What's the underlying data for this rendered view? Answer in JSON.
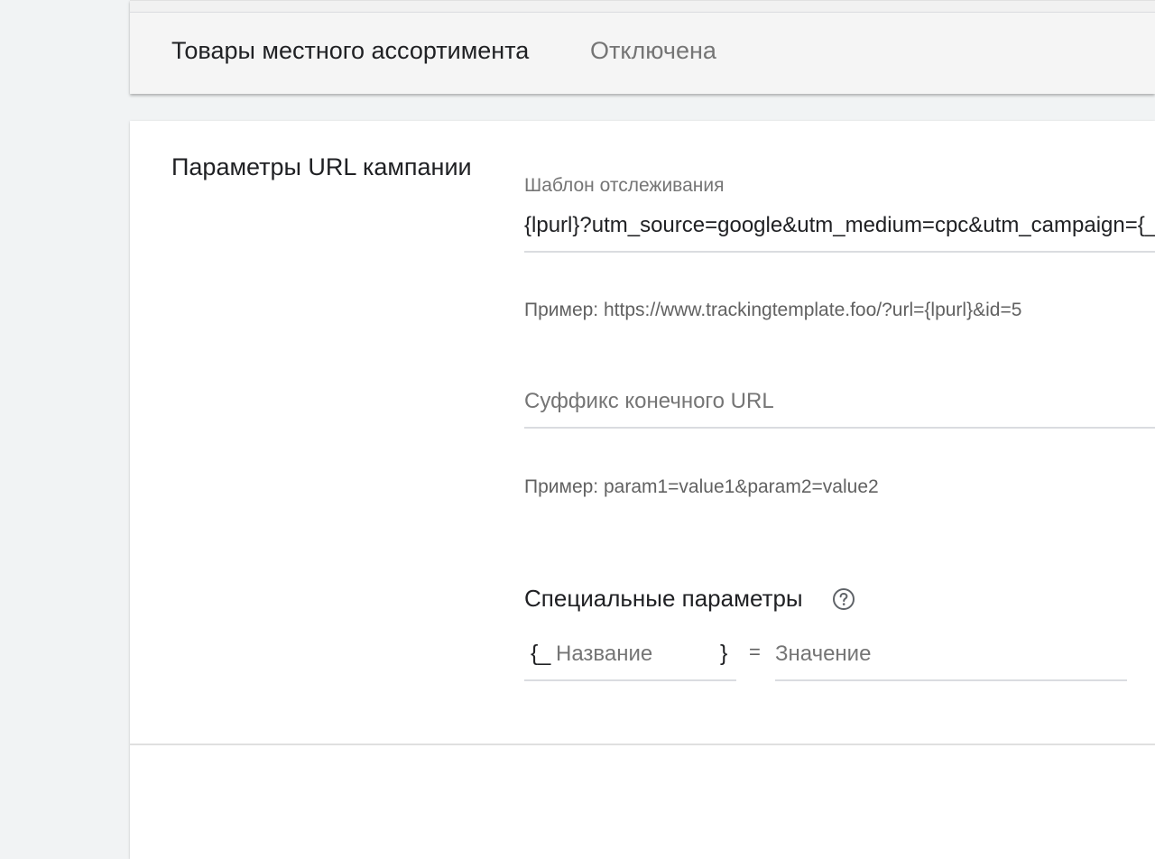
{
  "local_inventory_row": {
    "label": "Товары местного ассортимента",
    "status": "Отключена"
  },
  "url_options": {
    "section_title": "Параметры URL кампании",
    "tracking_template": {
      "label": "Шаблон отслеживания",
      "value": "{lpurl}?utm_source=google&utm_medium=cpc&utm_campaign={_campaign}",
      "hint": "Пример: https://www.trackingtemplate.foo/?url={lpurl}&id=5"
    },
    "final_url_suffix": {
      "placeholder": "Суффикс конечного URL",
      "hint": "Пример: param1=value1&param2=value2"
    },
    "custom_parameters": {
      "title": "Специальные параметры",
      "help_icon": "help-circle-icon",
      "brace_open": "{_",
      "brace_close": "}",
      "equals": "=",
      "name_placeholder": "Название",
      "value_placeholder": "Значение"
    }
  }
}
